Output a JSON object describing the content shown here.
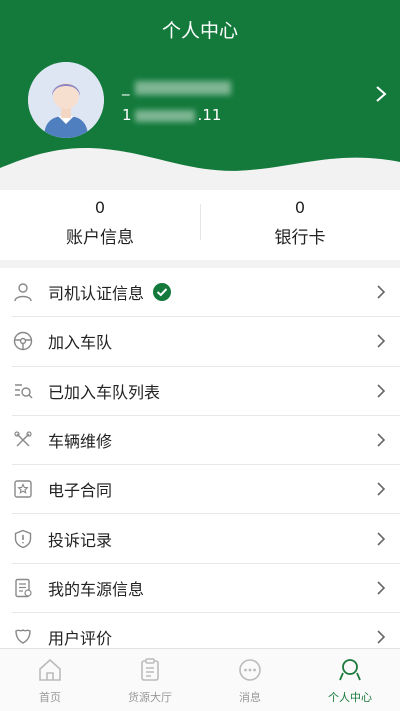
{
  "colors": {
    "brand": "#137a3b",
    "active_tab": "#1a7a3c",
    "icon_gray": "#888888"
  },
  "header": {
    "title": "个人中心",
    "user": {
      "name_prefix": "_",
      "phone_prefix": "1",
      "phone_suffix": ".11"
    }
  },
  "stats": [
    {
      "value": "0",
      "label": "账户信息"
    },
    {
      "value": "0",
      "label": "银行卡"
    }
  ],
  "menu": [
    {
      "label": "司机认证信息",
      "icon": "person-icon",
      "verified": true
    },
    {
      "label": "加入车队",
      "icon": "steering-wheel-icon"
    },
    {
      "label": "已加入车队列表",
      "icon": "list-search-icon"
    },
    {
      "label": "车辆维修",
      "icon": "tools-icon"
    },
    {
      "label": "电子合同",
      "icon": "contract-icon"
    },
    {
      "label": "投诉记录",
      "icon": "shield-alert-icon"
    },
    {
      "label": "我的车源信息",
      "icon": "document-icon"
    },
    {
      "label": "用户评价",
      "icon": "rating-icon"
    }
  ],
  "tabbar": [
    {
      "label": "首页",
      "icon": "home-icon",
      "active": false
    },
    {
      "label": "货源大厅",
      "icon": "clipboard-icon",
      "active": false
    },
    {
      "label": "消息",
      "icon": "message-icon",
      "active": false
    },
    {
      "label": "个人中心",
      "icon": "user-icon",
      "active": true
    }
  ]
}
